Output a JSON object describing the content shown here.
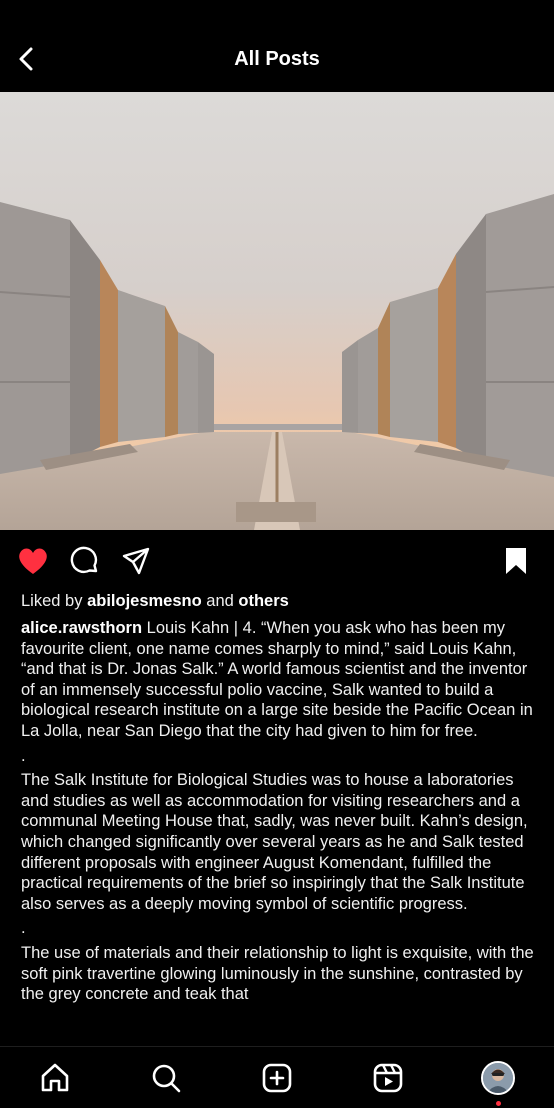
{
  "header": {
    "title": "All Posts"
  },
  "icons": {
    "back": "chevron-left-icon",
    "like": "heart-icon",
    "comment": "comment-bubble-icon",
    "share": "paper-plane-icon",
    "save": "bookmark-icon",
    "home": "home-icon",
    "search": "search-icon",
    "create": "plus-square-icon",
    "reels": "reels-icon",
    "profile": "profile-avatar"
  },
  "colors": {
    "like_active": "#ff3040",
    "background": "#000000",
    "text": "#f5f5f5"
  },
  "post": {
    "liked": true,
    "saved": true,
    "likes": {
      "prefix": "Liked by",
      "user": "abilojesmesno",
      "conj": "and",
      "others": "others"
    },
    "author": "alice.rawsthorn",
    "caption": [
      "Louis Kahn | 4. “When you ask who has been my favourite client, one name comes sharply to mind,” said Louis Kahn, “and that is Dr. Jonas Salk.” A world famous scientist and the inventor of an immensely successful polio vaccine, Salk wanted to build a biological research institute on a large site beside the Pacific Ocean in La Jolla, near San Diego that the city had given to him for free.",
      ".",
      "The Salk Institute for Biological Studies was to house a laboratories and studies as well as accommodation for visiting researchers and a communal Meeting House that, sadly, was never built. Kahn’s design, which changed significantly over several years as he and Salk tested different proposals with engineer August Komendant, fulfilled the practical requirements of the brief so inspiringly that the Salk Institute also serves as a deeply moving symbol of scientific progress.",
      ".",
      "The use of materials and their relationship to light is exquisite, with the soft pink travertine glowing luminously in the sunshine, contrasted by the grey concrete and teak that"
    ]
  }
}
